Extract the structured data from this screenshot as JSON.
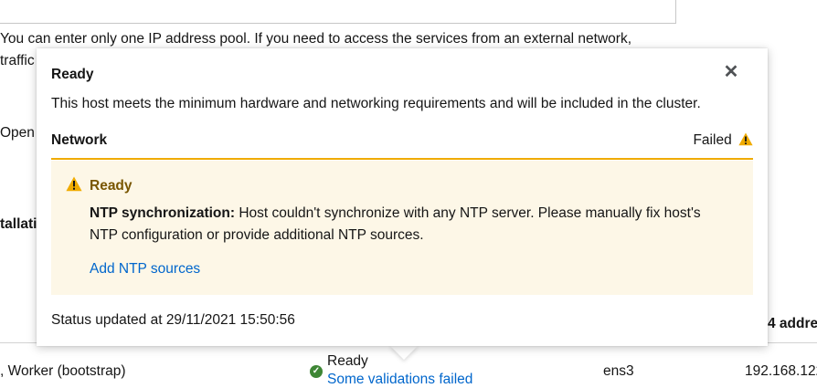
{
  "background": {
    "pool_note_line1": "You can enter only one IP address pool. If you need to access the services from an external network,",
    "pool_note_line2": "traffic",
    "open_label": "Open",
    "install_label": "tallati",
    "ipv4_header": "4 addre",
    "host_row": {
      "role": ", Worker (bootstrap)",
      "status": "Ready",
      "status_link": "Some validations failed",
      "nic": "ens3",
      "ip": "192.168.122."
    }
  },
  "popover": {
    "title": "Ready",
    "description": "This host meets the minimum hardware and networking requirements and will be included in the cluster.",
    "section": {
      "label": "Network",
      "status": "Failed"
    },
    "alert": {
      "title": "Ready",
      "bold_prefix": "NTP synchronization:",
      "message": " Host couldn't synchronize with any NTP server. Please manually fix host's NTP configuration or provide additional NTP sources.",
      "link": "Add NTP sources"
    },
    "footer": "Status updated at 29/11/2021 15:50:56",
    "close_icon": "close-icon"
  },
  "colors": {
    "warning": "#f0ab00",
    "warning_bg": "#fdf7e7",
    "warning_title": "#795600",
    "link": "#0066cc",
    "success": "#3e8635"
  }
}
